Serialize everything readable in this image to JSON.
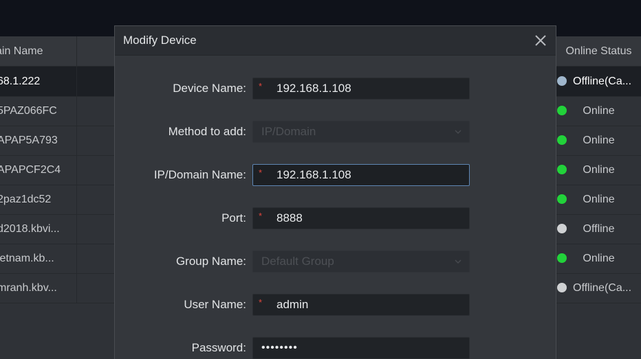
{
  "background_table": {
    "left_header": "ain Name",
    "left_rows": [
      {
        "text": "68.1.222",
        "selected": true
      },
      {
        "text": "5PAZ066FC",
        "selected": false
      },
      {
        "text": "APAP5A793",
        "selected": false
      },
      {
        "text": "APAPCF2C4",
        "selected": false
      },
      {
        "text": "2paz1dc52",
        "selected": false
      },
      {
        "text": "d2018.kbvi...",
        "selected": false
      },
      {
        "text": "ietnam.kb...",
        "selected": false
      },
      {
        "text": "mranh.kbv...",
        "selected": false
      }
    ],
    "right_header": "Online Status",
    "right_rows": [
      {
        "status": "Offline(Ca...",
        "dot_color": "#9fb6cc",
        "kind": "offline-ca",
        "selected": true
      },
      {
        "status": "Online",
        "dot_color": "#22d23a",
        "kind": "online",
        "selected": false
      },
      {
        "status": "Online",
        "dot_color": "#22d23a",
        "kind": "online",
        "selected": false
      },
      {
        "status": "Online",
        "dot_color": "#22d23a",
        "kind": "online",
        "selected": false
      },
      {
        "status": "Online",
        "dot_color": "#22d23a",
        "kind": "online",
        "selected": false
      },
      {
        "status": "Offline",
        "dot_color": "#cfd1d3",
        "kind": "offline",
        "selected": false
      },
      {
        "status": "Online",
        "dot_color": "#22d23a",
        "kind": "online",
        "selected": false
      },
      {
        "status": "Offline(Ca...",
        "dot_color": "#cfd1d3",
        "kind": "offline-ca",
        "selected": false
      }
    ]
  },
  "dialog": {
    "title": "Modify Device",
    "close_icon": "close-icon",
    "fields": {
      "device_name": {
        "label": "Device Name:",
        "value": "192.168.1.108",
        "required": "*"
      },
      "method_to_add": {
        "label": "Method to add:",
        "value": "IP/Domain"
      },
      "ip_domain": {
        "label": "IP/Domain Name:",
        "value": "192.168.1.108",
        "required": "*"
      },
      "port": {
        "label": "Port:",
        "value": "8888",
        "required": "*"
      },
      "group_name": {
        "label": "Group Name:",
        "value": "Default Group"
      },
      "user_name": {
        "label": "User Name:",
        "value": "admin",
        "required": "*"
      },
      "password": {
        "label": "Password:",
        "value": "••••••••"
      }
    }
  },
  "colors": {
    "required_star": "#e0463c",
    "focus_border": "#5e86b4",
    "online": "#22d23a",
    "offline": "#cfd1d3",
    "offline_camera": "#9fb6cc"
  }
}
